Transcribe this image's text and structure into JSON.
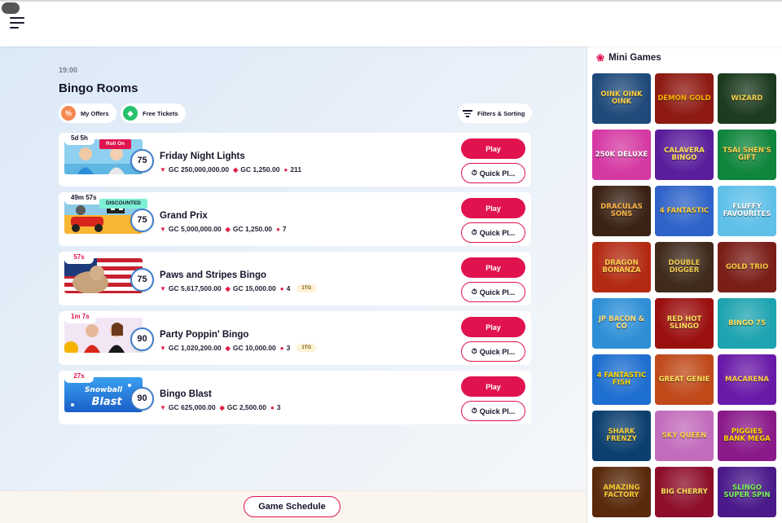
{
  "header": {
    "menu_icon": "hamburger-menu-icon"
  },
  "main": {
    "time": "19:00",
    "title": "Bingo Rooms",
    "chips": {
      "offers": "My Offers",
      "tickets": "Free Tickets",
      "filter": "Filters & Sorting"
    },
    "play_label": "Play",
    "quick_label": "Quick Pl...",
    "rooms": [
      {
        "name": "Friday Night Lights",
        "timer": "5d 5h",
        "tag": "Roll On",
        "ball": "75",
        "prize": "GC 250,000,000.00",
        "ticket": "GC 1,250.00",
        "players": "211",
        "ttg": ""
      },
      {
        "name": "Grand Prix",
        "timer": "49m 57s",
        "tag": "DISCOUNTED",
        "ball": "75",
        "prize": "GC 5,000,000.00",
        "ticket": "GC 1,250.00",
        "players": "7",
        "ttg": ""
      },
      {
        "name": "Paws and Stripes Bingo",
        "timer": "57s",
        "tag": "",
        "ball": "75",
        "prize": "GC 5,617,500.00",
        "ticket": "GC 15,000.00",
        "players": "4",
        "ttg": "1TG"
      },
      {
        "name": "Party Poppin' Bingo",
        "timer": "1m 7s",
        "tag": "",
        "ball": "90",
        "prize": "GC 1,020,200.00",
        "ticket": "GC 10,000.00",
        "players": "3",
        "ttg": "1TG"
      },
      {
        "name": "Bingo Blast",
        "timer": "27s",
        "tag": "",
        "ball": "90",
        "prize": "GC 625,000.00",
        "ticket": "GC 2,500.00",
        "players": "3",
        "ttg": "",
        "thumb_text": "Snowball Blast"
      }
    ]
  },
  "footer": {
    "schedule_label": "Game Schedule"
  },
  "sidebar": {
    "title": "Mini Games",
    "games": [
      {
        "label": "Oink Oink Oink",
        "bg": "#1f4a7a",
        "fg": "#ffcf3f"
      },
      {
        "label": "Demon Gold",
        "bg": "#8e1a12",
        "fg": "#ffb000"
      },
      {
        "label": "Wizard",
        "bg": "#1d3b1f",
        "fg": "#f2d04a"
      },
      {
        "label": "250K Deluxe",
        "bg": "#d53aa3",
        "fg": "#ffffff"
      },
      {
        "label": "Calavera Bingo",
        "bg": "#5a1e9c",
        "fg": "#ffe35c"
      },
      {
        "label": "Tsai Shen's Gift",
        "bg": "#10853d",
        "fg": "#ffd24a"
      },
      {
        "label": "Draculas Sons",
        "bg": "#3a2214",
        "fg": "#ffb347"
      },
      {
        "label": "4 Fantastic",
        "bg": "#2f63c9",
        "fg": "#ffcc33"
      },
      {
        "label": "Fluffy Favourites",
        "bg": "#5fc0e8",
        "fg": "#ffffff"
      },
      {
        "label": "Dragon Bonanza",
        "bg": "#b32a12",
        "fg": "#ffd14a"
      },
      {
        "label": "Double Digger",
        "bg": "#3f2a1c",
        "fg": "#f2c94c"
      },
      {
        "label": "Gold Trio",
        "bg": "#7a1e18",
        "fg": "#ffc83d"
      },
      {
        "label": "JP Bacon & Co",
        "bg": "#2f8fd6",
        "fg": "#ffe37a"
      },
      {
        "label": "Red Hot Slingo",
        "bg": "#9c1010",
        "fg": "#ffe15c"
      },
      {
        "label": "Bingo 75",
        "bg": "#1ea4b0",
        "fg": "#ffe15c"
      },
      {
        "label": "4 Fantastic Fish",
        "bg": "#1f6fd0",
        "fg": "#ffd700"
      },
      {
        "label": "Great Genie",
        "bg": "#c04a1a",
        "fg": "#ffe15c"
      },
      {
        "label": "Macarena",
        "bg": "#6a1aa8",
        "fg": "#ffd14a"
      },
      {
        "label": "Shark Frenzy",
        "bg": "#0c3f6e",
        "fg": "#f4d03f"
      },
      {
        "label": "Sky Queen",
        "bg": "#c26cbc",
        "fg": "#ffd14a"
      },
      {
        "label": "Piggies Bank Mega",
        "bg": "#8a1a8a",
        "fg": "#ffd700"
      },
      {
        "label": "Amazing Factory",
        "bg": "#5a2a0c",
        "fg": "#ffcc33"
      },
      {
        "label": "Big Cherry",
        "bg": "#8e0f2a",
        "fg": "#ffe15c"
      },
      {
        "label": "Slingo Super Spin",
        "bg": "#4a1a8a",
        "fg": "#7cf25b"
      }
    ]
  }
}
